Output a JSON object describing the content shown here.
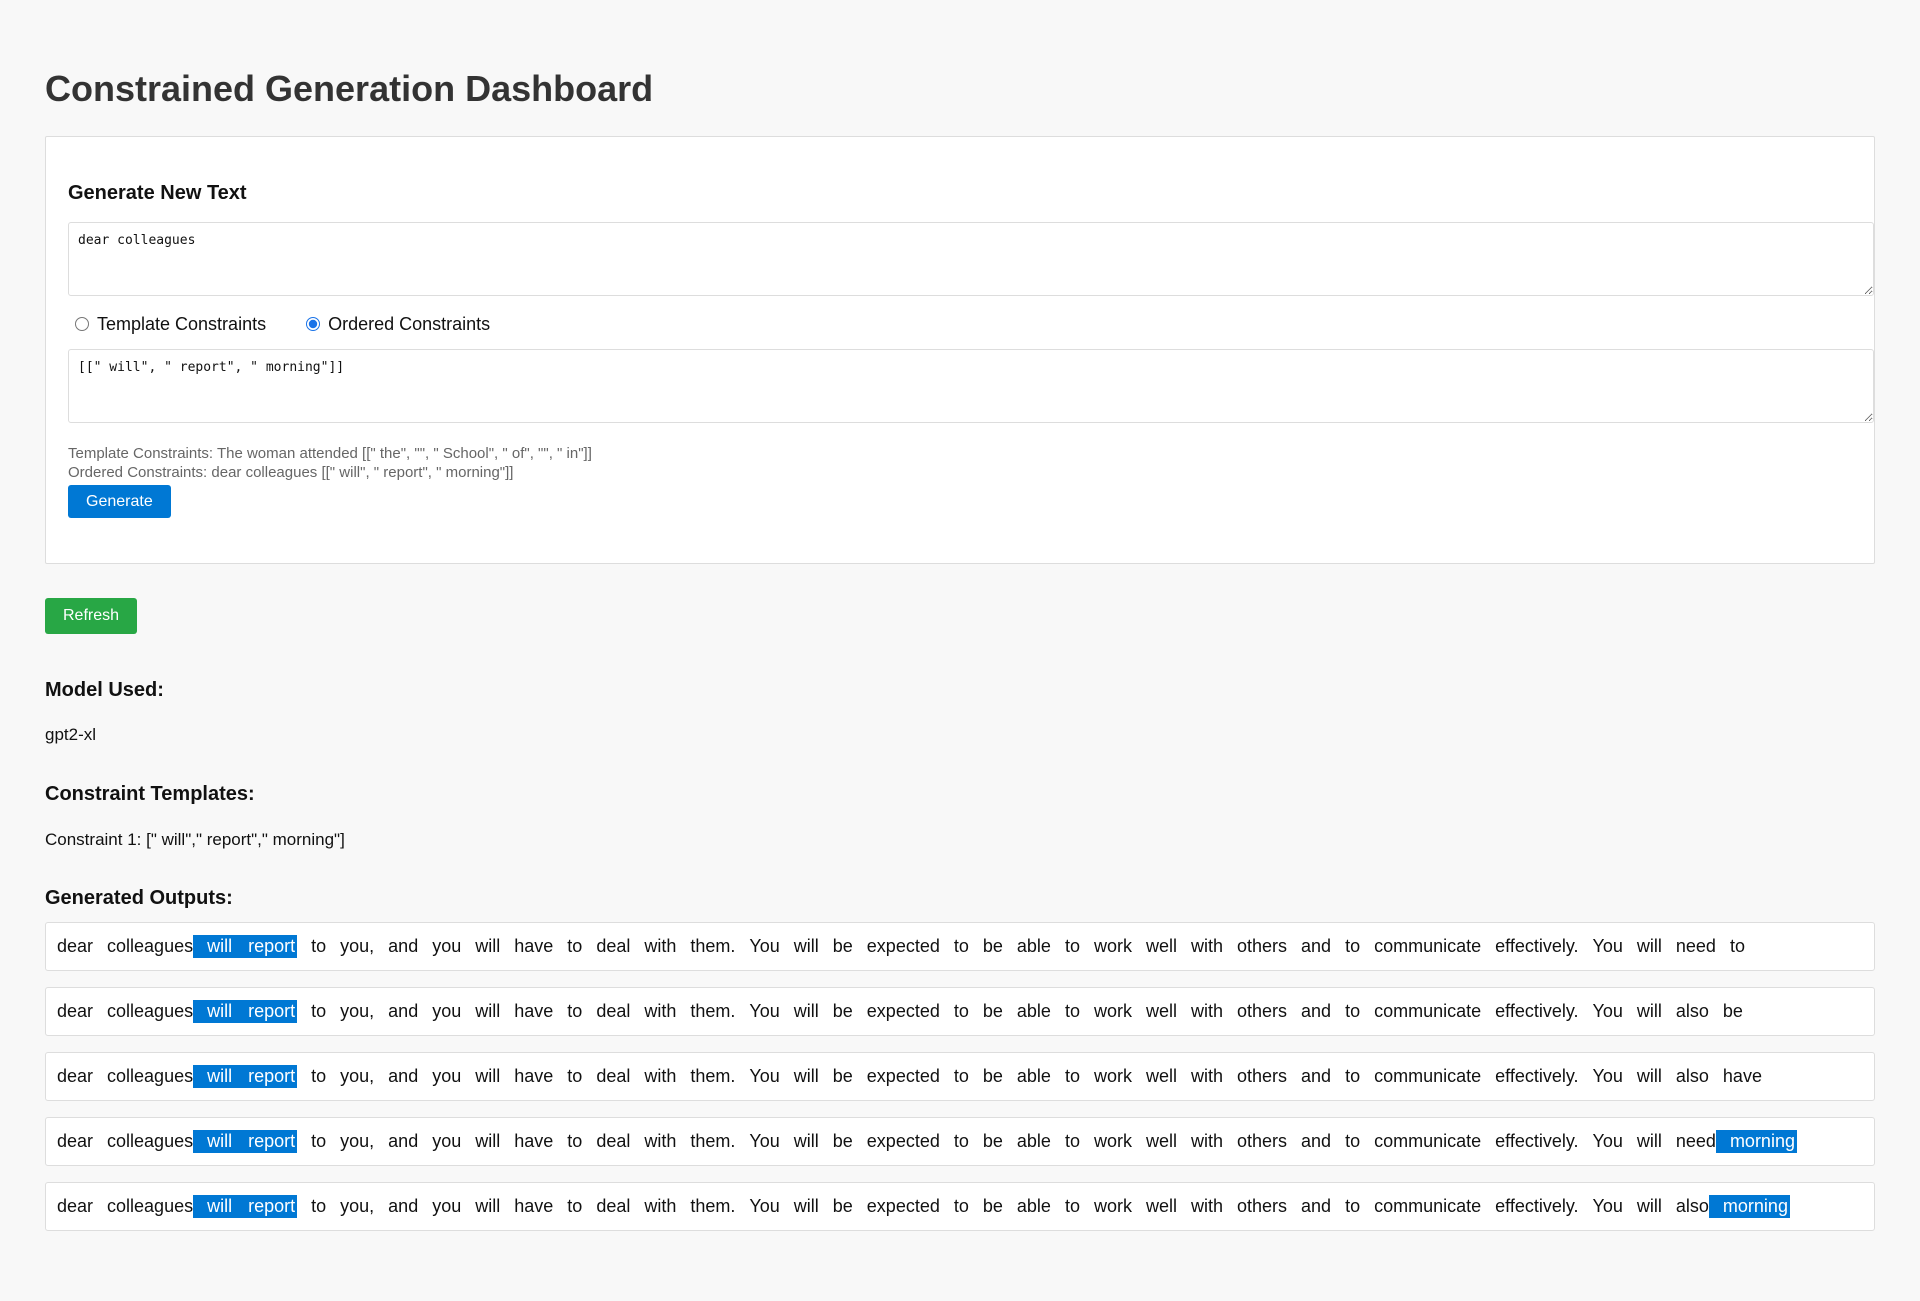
{
  "page_title": "Constrained Generation Dashboard",
  "form": {
    "heading": "Generate New Text",
    "prompt_value": "dear colleagues",
    "radio_template_label": "Template Constraints",
    "radio_ordered_label": "Ordered Constraints",
    "selected_mode": "ordered",
    "constraints_value": "[[\" will\", \" report\", \" morning\"]]",
    "help_template": "Template Constraints: The woman attended [[\" the\", \"\", \" School\", \" of\", \"\", \" in\"]]",
    "help_ordered": "Ordered Constraints: dear colleagues [[\" will\", \" report\", \" morning\"]]",
    "generate_label": "Generate"
  },
  "refresh_label": "Refresh",
  "model_section": {
    "heading": "Model Used:",
    "value": "gpt2-xl"
  },
  "templates_section": {
    "heading": "Constraint Templates:",
    "value": "Constraint 1: [\" will\",\" report\",\" morning\"]"
  },
  "outputs_section": {
    "heading": "Generated Outputs:",
    "highlight_color": "#0078d4",
    "outputs": [
      {
        "tokens": [
          {
            "t": "dear"
          },
          {
            "t": "colleagues"
          },
          {
            "t": "will",
            "hl": true
          },
          {
            "t": "report",
            "hl": true
          },
          {
            "t": "to"
          },
          {
            "t": "you,"
          },
          {
            "t": "and"
          },
          {
            "t": "you"
          },
          {
            "t": "will"
          },
          {
            "t": "have"
          },
          {
            "t": "to"
          },
          {
            "t": "deal"
          },
          {
            "t": "with"
          },
          {
            "t": "them."
          },
          {
            "t": "You"
          },
          {
            "t": "will"
          },
          {
            "t": "be"
          },
          {
            "t": "expected"
          },
          {
            "t": "to"
          },
          {
            "t": "be"
          },
          {
            "t": "able"
          },
          {
            "t": "to"
          },
          {
            "t": "work"
          },
          {
            "t": "well"
          },
          {
            "t": "with"
          },
          {
            "t": "others"
          },
          {
            "t": "and"
          },
          {
            "t": "to"
          },
          {
            "t": "communicate"
          },
          {
            "t": "effectively."
          },
          {
            "t": "You"
          },
          {
            "t": "will"
          },
          {
            "t": "need"
          },
          {
            "t": "to"
          }
        ]
      },
      {
        "tokens": [
          {
            "t": "dear"
          },
          {
            "t": "colleagues"
          },
          {
            "t": "will",
            "hl": true
          },
          {
            "t": "report",
            "hl": true
          },
          {
            "t": "to"
          },
          {
            "t": "you,"
          },
          {
            "t": "and"
          },
          {
            "t": "you"
          },
          {
            "t": "will"
          },
          {
            "t": "have"
          },
          {
            "t": "to"
          },
          {
            "t": "deal"
          },
          {
            "t": "with"
          },
          {
            "t": "them."
          },
          {
            "t": "You"
          },
          {
            "t": "will"
          },
          {
            "t": "be"
          },
          {
            "t": "expected"
          },
          {
            "t": "to"
          },
          {
            "t": "be"
          },
          {
            "t": "able"
          },
          {
            "t": "to"
          },
          {
            "t": "work"
          },
          {
            "t": "well"
          },
          {
            "t": "with"
          },
          {
            "t": "others"
          },
          {
            "t": "and"
          },
          {
            "t": "to"
          },
          {
            "t": "communicate"
          },
          {
            "t": "effectively."
          },
          {
            "t": "You"
          },
          {
            "t": "will"
          },
          {
            "t": "also"
          },
          {
            "t": "be"
          }
        ]
      },
      {
        "tokens": [
          {
            "t": "dear"
          },
          {
            "t": "colleagues"
          },
          {
            "t": "will",
            "hl": true
          },
          {
            "t": "report",
            "hl": true
          },
          {
            "t": "to"
          },
          {
            "t": "you,"
          },
          {
            "t": "and"
          },
          {
            "t": "you"
          },
          {
            "t": "will"
          },
          {
            "t": "have"
          },
          {
            "t": "to"
          },
          {
            "t": "deal"
          },
          {
            "t": "with"
          },
          {
            "t": "them."
          },
          {
            "t": "You"
          },
          {
            "t": "will"
          },
          {
            "t": "be"
          },
          {
            "t": "expected"
          },
          {
            "t": "to"
          },
          {
            "t": "be"
          },
          {
            "t": "able"
          },
          {
            "t": "to"
          },
          {
            "t": "work"
          },
          {
            "t": "well"
          },
          {
            "t": "with"
          },
          {
            "t": "others"
          },
          {
            "t": "and"
          },
          {
            "t": "to"
          },
          {
            "t": "communicate"
          },
          {
            "t": "effectively."
          },
          {
            "t": "You"
          },
          {
            "t": "will"
          },
          {
            "t": "also"
          },
          {
            "t": "have"
          }
        ]
      },
      {
        "tokens": [
          {
            "t": "dear"
          },
          {
            "t": "colleagues"
          },
          {
            "t": "will",
            "hl": true
          },
          {
            "t": "report",
            "hl": true
          },
          {
            "t": "to"
          },
          {
            "t": "you,"
          },
          {
            "t": "and"
          },
          {
            "t": "you"
          },
          {
            "t": "will"
          },
          {
            "t": "have"
          },
          {
            "t": "to"
          },
          {
            "t": "deal"
          },
          {
            "t": "with"
          },
          {
            "t": "them."
          },
          {
            "t": "You"
          },
          {
            "t": "will"
          },
          {
            "t": "be"
          },
          {
            "t": "expected"
          },
          {
            "t": "to"
          },
          {
            "t": "be"
          },
          {
            "t": "able"
          },
          {
            "t": "to"
          },
          {
            "t": "work"
          },
          {
            "t": "well"
          },
          {
            "t": "with"
          },
          {
            "t": "others"
          },
          {
            "t": "and"
          },
          {
            "t": "to"
          },
          {
            "t": "communicate"
          },
          {
            "t": "effectively."
          },
          {
            "t": "You"
          },
          {
            "t": "will"
          },
          {
            "t": "need"
          },
          {
            "t": "morning",
            "hl": true
          }
        ]
      },
      {
        "tokens": [
          {
            "t": "dear"
          },
          {
            "t": "colleagues"
          },
          {
            "t": "will",
            "hl": true
          },
          {
            "t": "report",
            "hl": true
          },
          {
            "t": "to"
          },
          {
            "t": "you,"
          },
          {
            "t": "and"
          },
          {
            "t": "you"
          },
          {
            "t": "will"
          },
          {
            "t": "have"
          },
          {
            "t": "to"
          },
          {
            "t": "deal"
          },
          {
            "t": "with"
          },
          {
            "t": "them."
          },
          {
            "t": "You"
          },
          {
            "t": "will"
          },
          {
            "t": "be"
          },
          {
            "t": "expected"
          },
          {
            "t": "to"
          },
          {
            "t": "be"
          },
          {
            "t": "able"
          },
          {
            "t": "to"
          },
          {
            "t": "work"
          },
          {
            "t": "well"
          },
          {
            "t": "with"
          },
          {
            "t": "others"
          },
          {
            "t": "and"
          },
          {
            "t": "to"
          },
          {
            "t": "communicate"
          },
          {
            "t": "effectively."
          },
          {
            "t": "You"
          },
          {
            "t": "will"
          },
          {
            "t": "also"
          },
          {
            "t": "morning",
            "hl": true
          }
        ]
      }
    ]
  }
}
